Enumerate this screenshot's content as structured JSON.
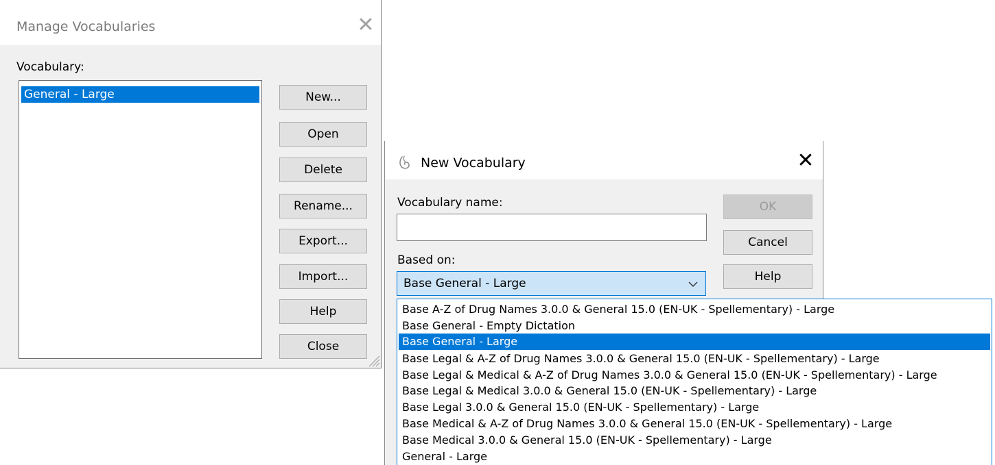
{
  "manage_dialog": {
    "title": "Manage Vocabularies",
    "close_glyph": "✕",
    "vocabulary_label": "Vocabulary:",
    "vocabularies": [
      "General - Large"
    ],
    "selected_index": 0,
    "buttons": {
      "new": "New...",
      "open": "Open",
      "delete": "Delete",
      "rename": "Rename...",
      "export": "Export...",
      "import": "Import...",
      "help": "Help",
      "close": "Close"
    }
  },
  "new_vocab_dialog": {
    "title": "New Vocabulary",
    "close_glyph": "✕",
    "name_label": "Vocabulary name:",
    "name_value": "",
    "based_on_label": "Based on:",
    "based_on_selected": "Base General - Large",
    "buttons": {
      "ok": "OK",
      "cancel": "Cancel",
      "help": "Help"
    },
    "ok_enabled": false
  },
  "dropdown": {
    "options": [
      "Base A-Z of Drug Names 3.0.0 & General 15.0 (EN-UK - Spellementary) - Large",
      "Base General - Empty Dictation",
      "Base General - Large",
      "Base Legal & A-Z of Drug Names 3.0.0 & General 15.0 (EN-UK - Spellementary) - Large",
      "Base Legal & Medical & A-Z of Drug Names 3.0.0 & General 15.0 (EN-UK - Spellementary) - Large",
      "Base Legal & Medical 3.0.0 & General 15.0 (EN-UK - Spellementary) - Large",
      "Base Legal 3.0.0 & General 15.0 (EN-UK - Spellementary) - Large",
      "Base Medical & A-Z of Drug Names 3.0.0 & General 15.0 (EN-UK - Spellementary) - Large",
      "Base Medical 3.0.0 & General 15.0 (EN-UK - Spellementary) - Large",
      "General - Large"
    ],
    "highlighted_index": 2
  },
  "colors": {
    "selection": "#0078d7",
    "combo_bg": "#cce4f7",
    "dialog_bg": "#f0f0f0"
  },
  "icons": {
    "manage_close": "close-icon",
    "new_close": "close-icon",
    "app": "dragon-icon",
    "combo": "chevron-down-icon",
    "grip": "resize-grip-icon"
  }
}
